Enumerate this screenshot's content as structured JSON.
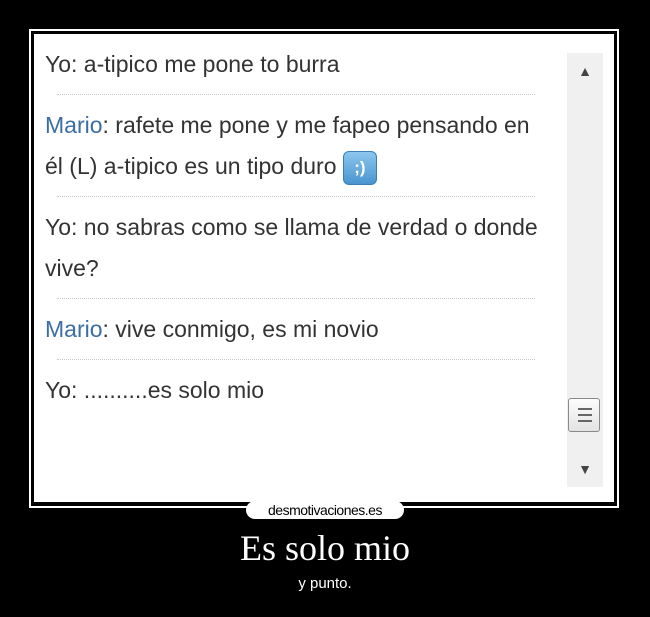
{
  "chat": {
    "messages": [
      {
        "speaker": "Yo",
        "text": ": a-tipico me pone to burra"
      },
      {
        "speaker": "Mario",
        "text": ": rafete me pone y me fapeo pensando en él (L) a-tipico es un tipo duro",
        "emoticon": ";)"
      },
      {
        "speaker": "Yo",
        "text": ": no sabras como se llama de verdad o donde vive?"
      },
      {
        "speaker": "Mario",
        "text": ": vive conmigo, es mi novio"
      },
      {
        "speaker": "Yo",
        "text": ": ..........es solo mio"
      }
    ]
  },
  "scrollbar": {
    "up_icon": "triangle-up",
    "down_icon": "triangle-down"
  },
  "watermark": "desmotivaciones.es",
  "poster": {
    "title": "Es solo mio",
    "subtitle": "y punto."
  },
  "colors": {
    "speaker_self": "#333333",
    "speaker_other": "#3a6ea5",
    "background": "#000000"
  }
}
